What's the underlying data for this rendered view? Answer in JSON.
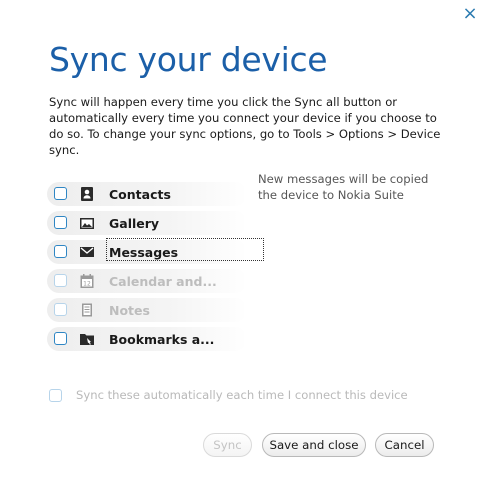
{
  "dialog": {
    "close_glyph": "×",
    "title": "Sync your device",
    "description": "Sync will happen every time you click the Sync all button or automatically every time you connect your device if you choose to do so. To change your sync options, go to Tools > Options > Device sync."
  },
  "items": [
    {
      "label": "Contacts",
      "icon": "contacts-icon",
      "checked": false,
      "enabled": true
    },
    {
      "label": "Gallery",
      "icon": "gallery-icon",
      "checked": false,
      "enabled": true
    },
    {
      "label": "Messages",
      "icon": "messages-icon",
      "checked": false,
      "enabled": true,
      "focused": true
    },
    {
      "label": "Calendar and...",
      "icon": "calendar-icon",
      "checked": false,
      "enabled": false
    },
    {
      "label": "Notes",
      "icon": "notes-icon",
      "checked": false,
      "enabled": false
    },
    {
      "label": "Bookmarks a...",
      "icon": "bookmarks-icon",
      "checked": false,
      "enabled": true
    }
  ],
  "tooltip": "New messages will be copied the device to Nokia Suite",
  "auto_sync": {
    "label": "Sync these automatically each time I connect this device",
    "checked": false,
    "enabled": false
  },
  "buttons": {
    "sync": "Sync",
    "save": "Save and close",
    "cancel": "Cancel"
  },
  "colors": {
    "accent": "#1b5fa8",
    "checkbox": "#2f86c4"
  }
}
